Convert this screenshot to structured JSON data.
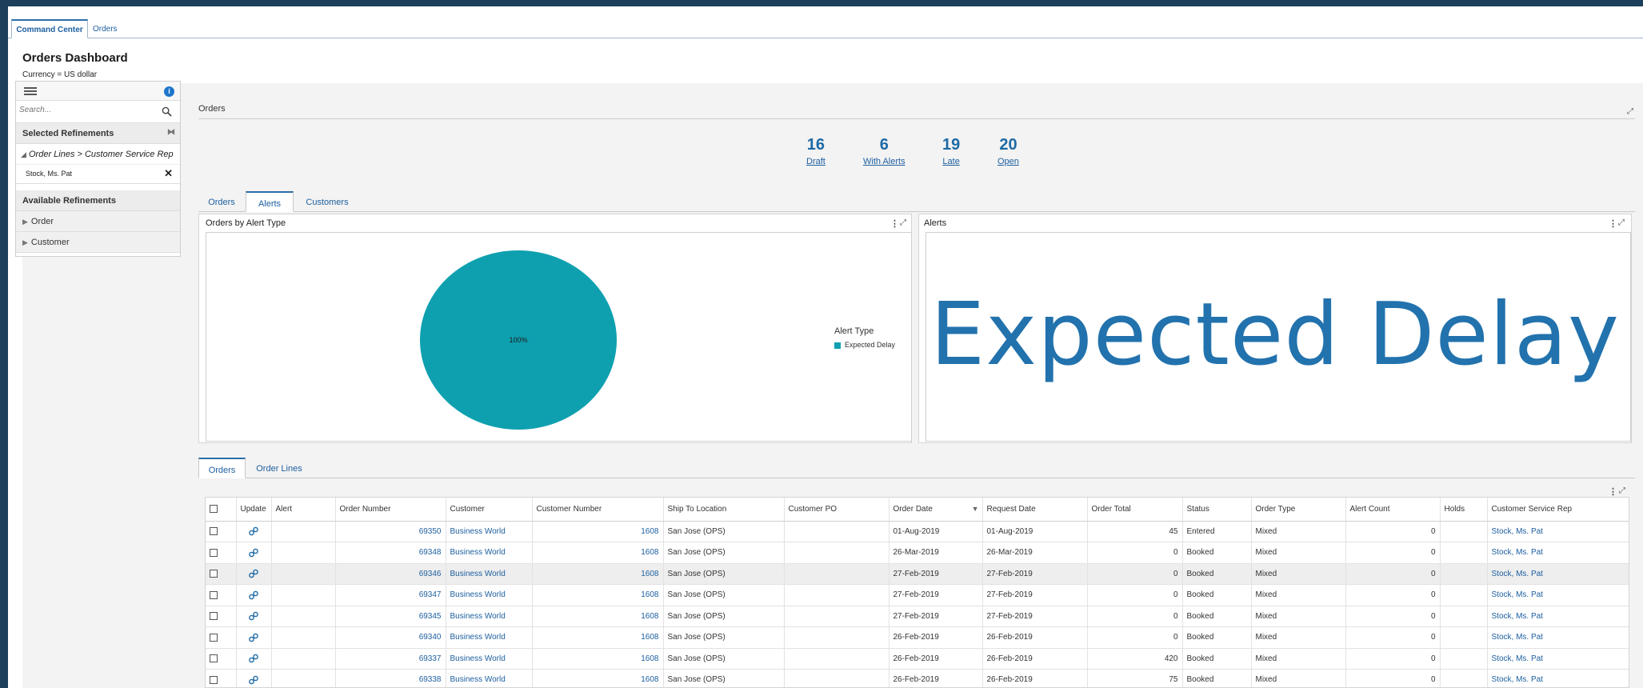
{
  "tabs": [
    {
      "label": "Command Center",
      "active": true
    },
    {
      "label": "Orders",
      "active": false
    }
  ],
  "page": {
    "title": "Orders Dashboard",
    "currency": "Currency =  US dollar"
  },
  "sidebar": {
    "search_placeholder": "Search...",
    "selected_title": "Selected Refinements",
    "crumb": "Order Lines > Customer Service Rep",
    "chip": "Stock, Ms. Pat",
    "available_title": "Available Refinements",
    "groups": [
      "Order",
      "Customer"
    ]
  },
  "orders_section": {
    "title": "Orders",
    "metrics": [
      {
        "value": "16",
        "label": "Draft"
      },
      {
        "value": "6",
        "label": "With Alerts"
      },
      {
        "value": "19",
        "label": "Late"
      },
      {
        "value": "20",
        "label": "Open"
      }
    ]
  },
  "mid_tabs": [
    {
      "label": "Orders",
      "active": false
    },
    {
      "label": "Alerts",
      "active": true
    },
    {
      "label": "Customers",
      "active": false
    }
  ],
  "chart_panel": {
    "title": "Orders by Alert Type",
    "slice_label": "100%",
    "legend_title": "Alert Type",
    "slice_color": "#0fa0b0"
  },
  "chart_data": {
    "type": "pie",
    "title": "Orders by Alert Type",
    "legend_title": "Alert Type",
    "categories": [
      "Expected Delay"
    ],
    "values": [
      100
    ],
    "labels": [
      "100%"
    ],
    "colors": [
      "#0fa0b0"
    ],
    "legend_position": "right"
  },
  "alerts_panel": {
    "title": "Alerts",
    "text": "Expected Delay"
  },
  "bottom_tabs": [
    {
      "label": "Orders",
      "active": true
    },
    {
      "label": "Order Lines",
      "active": false
    }
  ],
  "table": {
    "columns": [
      "",
      "Update",
      "Alert",
      "Order Number",
      "Customer",
      "Customer Number",
      "Ship To Location",
      "Customer PO",
      "Order Date",
      "Request Date",
      "Order Total",
      "Status",
      "Order Type",
      "Alert Count",
      "Holds",
      "Customer Service Rep"
    ],
    "rows": [
      {
        "order_number": "69350",
        "customer": "Business World",
        "customer_number": "1608",
        "ship_to": "San Jose (OPS)",
        "customer_po": "",
        "order_date": "01-Aug-2019",
        "request_date": "01-Aug-2019",
        "order_total": "45",
        "status": "Entered",
        "order_type": "Mixed",
        "alert_count": "0",
        "holds": "",
        "rep": "Stock, Ms. Pat"
      },
      {
        "order_number": "69348",
        "customer": "Business World",
        "customer_number": "1608",
        "ship_to": "San Jose (OPS)",
        "customer_po": "",
        "order_date": "26-Mar-2019",
        "request_date": "26-Mar-2019",
        "order_total": "0",
        "status": "Booked",
        "order_type": "Mixed",
        "alert_count": "0",
        "holds": "",
        "rep": "Stock, Ms. Pat"
      },
      {
        "order_number": "69346",
        "customer": "Business World",
        "customer_number": "1608",
        "ship_to": "San Jose (OPS)",
        "customer_po": "",
        "order_date": "27-Feb-2019",
        "request_date": "27-Feb-2019",
        "order_total": "0",
        "status": "Booked",
        "order_type": "Mixed",
        "alert_count": "0",
        "holds": "",
        "rep": "Stock, Ms. Pat",
        "highlight": true
      },
      {
        "order_number": "69347",
        "customer": "Business World",
        "customer_number": "1608",
        "ship_to": "San Jose (OPS)",
        "customer_po": "",
        "order_date": "27-Feb-2019",
        "request_date": "27-Feb-2019",
        "order_total": "0",
        "status": "Booked",
        "order_type": "Mixed",
        "alert_count": "0",
        "holds": "",
        "rep": "Stock, Ms. Pat"
      },
      {
        "order_number": "69345",
        "customer": "Business World",
        "customer_number": "1608",
        "ship_to": "San Jose (OPS)",
        "customer_po": "",
        "order_date": "27-Feb-2019",
        "request_date": "27-Feb-2019",
        "order_total": "0",
        "status": "Booked",
        "order_type": "Mixed",
        "alert_count": "0",
        "holds": "",
        "rep": "Stock, Ms. Pat"
      },
      {
        "order_number": "69340",
        "customer": "Business World",
        "customer_number": "1608",
        "ship_to": "San Jose (OPS)",
        "customer_po": "",
        "order_date": "26-Feb-2019",
        "request_date": "26-Feb-2019",
        "order_total": "0",
        "status": "Booked",
        "order_type": "Mixed",
        "alert_count": "0",
        "holds": "",
        "rep": "Stock, Ms. Pat"
      },
      {
        "order_number": "69337",
        "customer": "Business World",
        "customer_number": "1608",
        "ship_to": "San Jose (OPS)",
        "customer_po": "",
        "order_date": "26-Feb-2019",
        "request_date": "26-Feb-2019",
        "order_total": "420",
        "status": "Booked",
        "order_type": "Mixed",
        "alert_count": "0",
        "holds": "",
        "rep": "Stock, Ms. Pat"
      },
      {
        "order_number": "69338",
        "customer": "Business World",
        "customer_number": "1608",
        "ship_to": "San Jose (OPS)",
        "customer_po": "",
        "order_date": "26-Feb-2019",
        "request_date": "26-Feb-2019",
        "order_total": "75",
        "status": "Booked",
        "order_type": "Mixed",
        "alert_count": "0",
        "holds": "",
        "rep": "Stock, Ms. Pat"
      }
    ]
  },
  "icons": {
    "menu": "hamburger-icon",
    "info": "info-icon",
    "search": "search-icon",
    "clear": "clear-filter-icon",
    "remove": "close-icon",
    "expand": "expand-icon",
    "more": "vertical-dots-icon",
    "update": "link-icon",
    "sort": "sort-descending-icon"
  },
  "colors": {
    "accent": "#1d5fa0",
    "metric": "#1d6aa5",
    "frame": "#1e3f5c",
    "alert_text": "#2272ad"
  }
}
